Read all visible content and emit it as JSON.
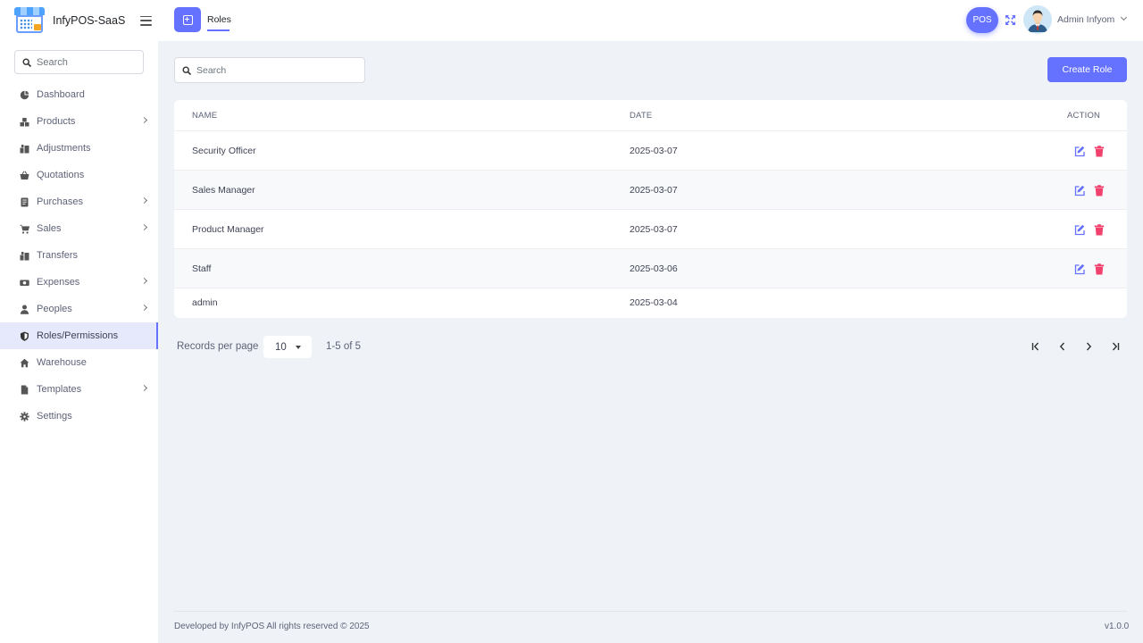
{
  "brand": {
    "name": "InfyPOS-SaaS"
  },
  "sidebar": {
    "search_placeholder": "Search",
    "items": [
      {
        "label": "Dashboard",
        "icon": "dashboard-icon",
        "has_children": false
      },
      {
        "label": "Products",
        "icon": "products-icon",
        "has_children": true
      },
      {
        "label": "Adjustments",
        "icon": "adjustments-icon",
        "has_children": false
      },
      {
        "label": "Quotations",
        "icon": "basket-icon",
        "has_children": false
      },
      {
        "label": "Purchases",
        "icon": "purchases-icon",
        "has_children": true
      },
      {
        "label": "Sales",
        "icon": "cart-icon",
        "has_children": true
      },
      {
        "label": "Transfers",
        "icon": "transfers-icon",
        "has_children": false
      },
      {
        "label": "Expenses",
        "icon": "money-icon",
        "has_children": true
      },
      {
        "label": "Peoples",
        "icon": "user-icon",
        "has_children": true
      },
      {
        "label": "Roles/Permissions",
        "icon": "shield-icon",
        "has_children": false,
        "active": true
      },
      {
        "label": "Warehouse",
        "icon": "home-icon",
        "has_children": false
      },
      {
        "label": "Templates",
        "icon": "file-icon",
        "has_children": true
      },
      {
        "label": "Settings",
        "icon": "gear-icon",
        "has_children": false
      }
    ]
  },
  "header": {
    "tab_label": "Roles",
    "pos_label": "POS",
    "user_name": "Admin Infyom"
  },
  "main": {
    "search_placeholder": "Search",
    "create_label": "Create Role",
    "columns": {
      "name": "NAME",
      "date": "DATE",
      "action": "ACTION"
    },
    "rows": [
      {
        "name": "Security Officer",
        "date": "2025-03-07",
        "actions": true
      },
      {
        "name": "Sales Manager",
        "date": "2025-03-07",
        "actions": true
      },
      {
        "name": "Product Manager",
        "date": "2025-03-07",
        "actions": true
      },
      {
        "name": "Staff",
        "date": "2025-03-06",
        "actions": true
      },
      {
        "name": "admin",
        "date": "2025-03-04",
        "actions": false
      }
    ]
  },
  "pagination": {
    "records_label": "Records per page",
    "per_page": "10",
    "range_text": "1-5 of 5"
  },
  "footer": {
    "text": "Developed by InfyPOS All rights reserved © 2025",
    "version": "v1.0.0"
  },
  "colors": {
    "accent": "#6571ff",
    "edit": "#6571ff",
    "delete": "#f1416c",
    "background": "#eff3f7"
  }
}
